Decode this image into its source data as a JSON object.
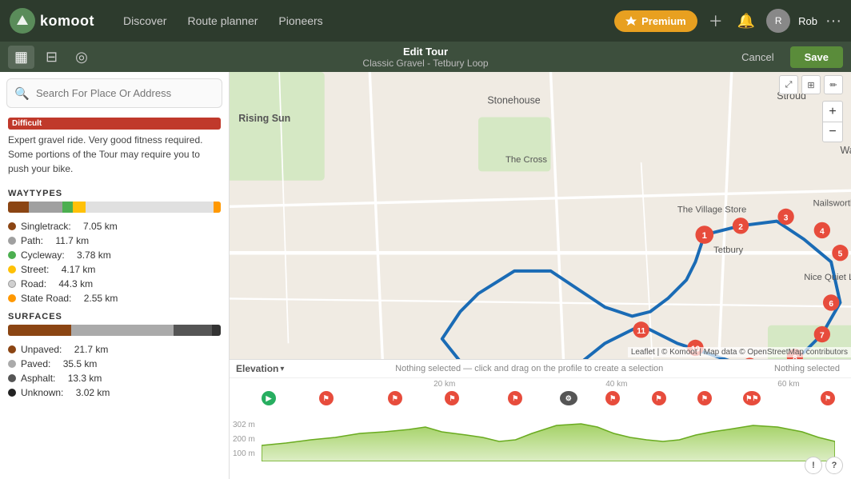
{
  "topnav": {
    "logo": "komoot",
    "links": [
      "Discover",
      "Route planner",
      "Pioneers"
    ],
    "premium_label": "Premium",
    "add_icon": "+",
    "user": "Rob"
  },
  "subnav": {
    "edit_tour_label": "Edit Tour",
    "tour_name": "Classic Gravel - Tetbury Loop",
    "cancel_label": "Cancel",
    "save_label": "Save"
  },
  "search": {
    "placeholder": "Search For Place Or Address"
  },
  "difficulty": "Difficult",
  "description": "Expert gravel ride. Very good fitness required. Some portions of the Tour may require you to push your bike.",
  "waytypes": {
    "section_title": "WAYTYPES",
    "items": [
      {
        "label": "Singletrack:",
        "value": "7.05 km",
        "color": "#8B4513"
      },
      {
        "label": "Path:",
        "value": "11.7 km",
        "color": "#a0a0a0"
      },
      {
        "label": "Cycleway:",
        "value": "3.78 km",
        "color": "#4CAF50"
      },
      {
        "label": "Street:",
        "value": "4.17 km",
        "color": "#FFC107"
      },
      {
        "label": "Road:",
        "value": "44.3 km",
        "color": "#d0d0d0"
      },
      {
        "label": "State Road:",
        "value": "2.55 km",
        "color": "#FF9800"
      }
    ]
  },
  "surfaces": {
    "section_title": "SURFACES",
    "items": [
      {
        "label": "Unpaved:",
        "value": "21.7 km",
        "color": "#8B4513"
      },
      {
        "label": "Paved:",
        "value": "35.5 km",
        "color": "#aaaaaa"
      },
      {
        "label": "Asphalt:",
        "value": "13.3 km",
        "color": "#555555"
      },
      {
        "label": "Unknown:",
        "value": "3.02 km",
        "color": "#222222"
      }
    ]
  },
  "elevation": {
    "title": "Elevation",
    "status_left": "Nothing selected — click and drag on the profile to create a selection",
    "status_right": "Nothing selected",
    "km_markers": [
      "20 km",
      "40 km",
      "60 km"
    ],
    "max_m": "302 m",
    "mid_m": "200 m",
    "low_m": "100 m"
  },
  "map": {
    "zoom_in": "+",
    "zoom_out": "−",
    "attribution": "Leaflet | © Komoot | Map data © OpenStreetMap contributors"
  },
  "info_buttons": [
    "?",
    "?"
  ]
}
